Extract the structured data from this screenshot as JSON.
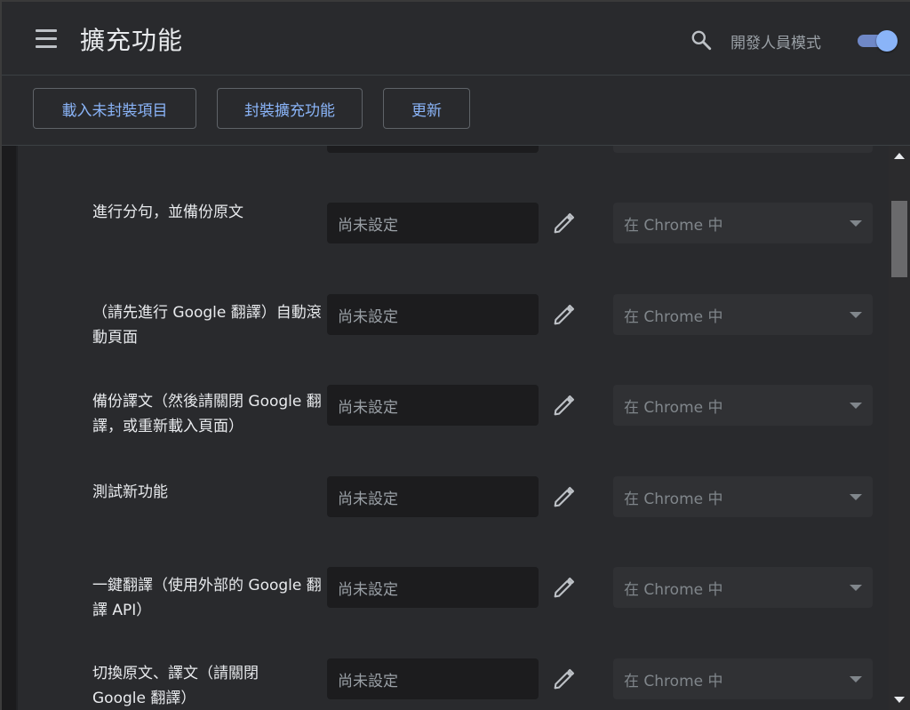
{
  "header": {
    "title": "擴充功能",
    "dev_mode_label": "開發人員模式",
    "dev_mode_on": true
  },
  "toolbar": {
    "load_unpacked": "載入未封裝項目",
    "pack_extension": "封裝擴充功能",
    "update": "更新"
  },
  "shortcuts": [
    {
      "label": "進行分句，並備份原文",
      "shortcut": "尚未設定",
      "scope": "在 Chrome 中"
    },
    {
      "label": "（請先進行 Google 翻譯）自動滾動頁面",
      "shortcut": "尚未設定",
      "scope": "在 Chrome 中"
    },
    {
      "label": "備份譯文（然後請關閉 Google 翻譯，或重新載入頁面）",
      "shortcut": "尚未設定",
      "scope": "在 Chrome 中"
    },
    {
      "label": "測試新功能",
      "shortcut": "尚未設定",
      "scope": "在 Chrome 中"
    },
    {
      "label": "一鍵翻譯（使用外部的 Google 翻譯 API）",
      "shortcut": "尚未設定",
      "scope": "在 Chrome 中"
    },
    {
      "label": "切換原文、譯文（請關閉 Google 翻譯）",
      "shortcut": "尚未設定",
      "scope": "在 Chrome 中"
    }
  ],
  "colors": {
    "accent": "#8ab4f8",
    "background": "#202124",
    "surface": "#292a2d"
  },
  "icons": {
    "menu": "menu-icon",
    "search": "search-icon",
    "edit": "pencil-icon"
  }
}
